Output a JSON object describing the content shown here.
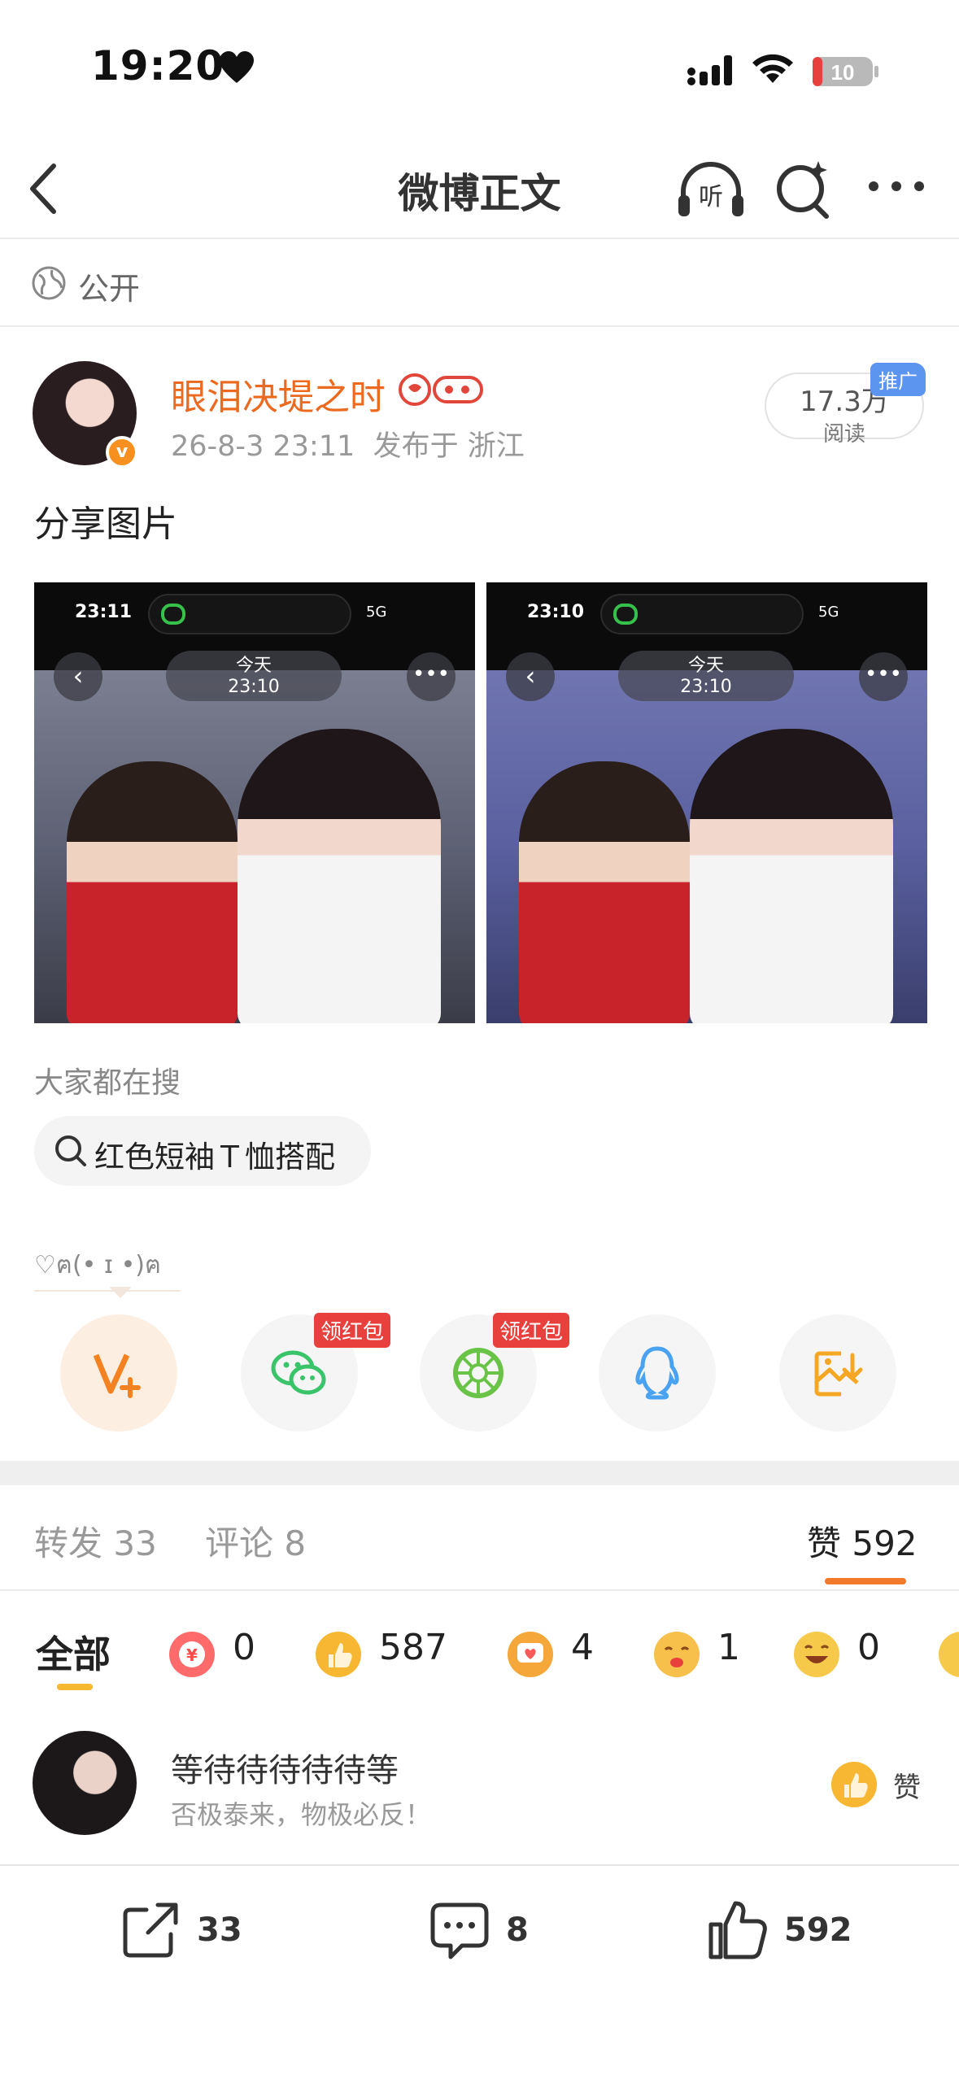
{
  "status_bar": {
    "time": "19:20",
    "battery": "10"
  },
  "nav": {
    "title": "微博正文",
    "listen_label": "听"
  },
  "visibility": {
    "label": "公开"
  },
  "post": {
    "author": "眼泪决堤之时",
    "timestamp": "26-8-3 23:11",
    "location": "发布于 浙江",
    "reads_count": "17.3万",
    "reads_label": "阅读",
    "promo_tag": "推广",
    "text": "分享图片",
    "images": [
      {
        "time": "23:11",
        "status": "5G",
        "today": "今天",
        "today_time": "23:10"
      },
      {
        "time": "23:10",
        "status": "5G",
        "today": "今天",
        "today_time": "23:10"
      }
    ]
  },
  "suggestions": {
    "title": "大家都在搜",
    "chip": "红色短袖Ｔ恤搭配"
  },
  "kaomoji": "♡ฅ(• ɪ •)ฅ",
  "share": {
    "redpack_label_1": "领红包",
    "redpack_label_2": "领红包"
  },
  "tabs": {
    "repost": "转发 33",
    "comment": "评论 8",
    "like": "赞 592"
  },
  "reactions": {
    "all_label": "全部",
    "items": [
      {
        "icon": "red-envelope-emoji",
        "color": "#ff5a5a",
        "count": "0"
      },
      {
        "icon": "thumbs-up-emoji",
        "color": "#f7b733",
        "count": "587"
      },
      {
        "icon": "heart-bubble-emoji",
        "color": "#f5a73a",
        "count": "4"
      },
      {
        "icon": "kiss-emoji",
        "color": "#f7c04a",
        "count": "1"
      },
      {
        "icon": "laugh-emoji",
        "color": "#f7c94a",
        "count": "0"
      }
    ]
  },
  "liker": {
    "name": "等待待待待待等",
    "signature": "否极泰来，物极必反！",
    "action": "赞"
  },
  "bottom_bar": {
    "repost": "33",
    "comment": "8",
    "like": "592"
  },
  "colors": {
    "accent": "#ec6a1f",
    "underline": "#f27a2b",
    "promo": "#5b95f0",
    "redpack": "#e8403c"
  }
}
